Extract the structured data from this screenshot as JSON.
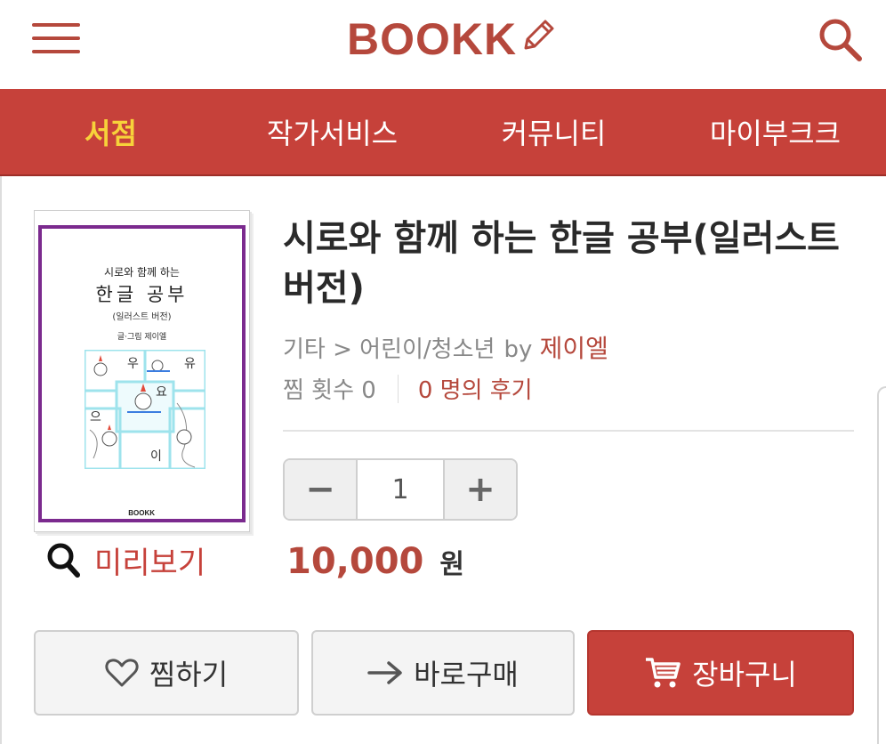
{
  "header": {
    "logo_text": "BOOKK",
    "menu_icon": "hamburger-menu-icon",
    "search_icon": "search-icon"
  },
  "nav": {
    "items": [
      {
        "label": "서점",
        "active": true
      },
      {
        "label": "작가서비스",
        "active": false
      },
      {
        "label": "커뮤니티",
        "active": false
      },
      {
        "label": "마이부크크",
        "active": false
      }
    ]
  },
  "book": {
    "title": "시로와 함께 하는 한글 공부(일러스트 버전)",
    "category": "기타 > 어린이/청소년",
    "by_label": "by",
    "author": "제이엘",
    "wish_count_label": "찜 횟수 0",
    "reviews_label": "0 명의 후기",
    "cover": {
      "subtitle": "시로와 함께 하는",
      "title": "한글 공부",
      "edition": "(일러스트 버전)",
      "author_line": "글·그림 제이엘",
      "brand": "BOOKK",
      "syllables": [
        "우",
        "유",
        "요",
        "으",
        "이"
      ]
    }
  },
  "preview": {
    "label": "미리보기"
  },
  "quantity": {
    "minus": "−",
    "value": "1",
    "plus": "+"
  },
  "price": {
    "amount": "10,000",
    "unit": "원"
  },
  "actions": {
    "wish_label": "찜하기",
    "buy_label": "바로구매",
    "cart_label": "장바구니"
  },
  "colors": {
    "brand": "#c6413a",
    "logo": "#b5483c",
    "nav_active": "#f7d23a",
    "cover_border": "#7b2a8e"
  }
}
